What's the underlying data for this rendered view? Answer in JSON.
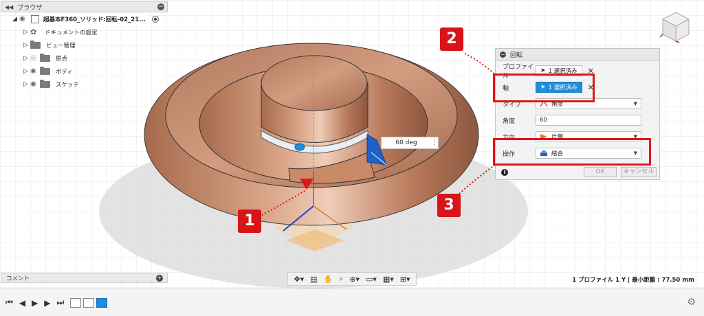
{
  "browser": {
    "title": "ブラウザ",
    "root_label": "超基本F360_ソリッド:回転-02_21...",
    "items": [
      {
        "label": "ドキュメントの設定",
        "icon": "gear-icon"
      },
      {
        "label": "ビュー管理",
        "icon": "folder-icon"
      },
      {
        "label": "原点",
        "icon": "folder-icon"
      },
      {
        "label": "ボディ",
        "icon": "folder-icon"
      },
      {
        "label": "スケッチ",
        "icon": "folder-icon"
      }
    ]
  },
  "dialog": {
    "title": "回転",
    "profile_label": "プロファイル",
    "profile_value": "1 選択済み",
    "axis_label": "軸",
    "axis_value": "1 選択済み",
    "type_label": "タイプ",
    "type_value": "角度",
    "angle_label": "角度",
    "angle_value": "60",
    "direction_label": "方向",
    "direction_value": "片側",
    "operation_label": "操作",
    "operation_value": "結合",
    "ok_label": "OK",
    "cancel_label": "キャンセル"
  },
  "angle_box": {
    "value": "60 deg"
  },
  "callouts": [
    "1",
    "2",
    "3"
  ],
  "comments": {
    "label": "コメント"
  },
  "status": {
    "text": "1 プロファイル 1 Y | 最小距離 : 77.50 mm"
  },
  "colors": {
    "highlight": "#e0141b",
    "accent": "#1e8ddb",
    "model": "#c98a68"
  }
}
